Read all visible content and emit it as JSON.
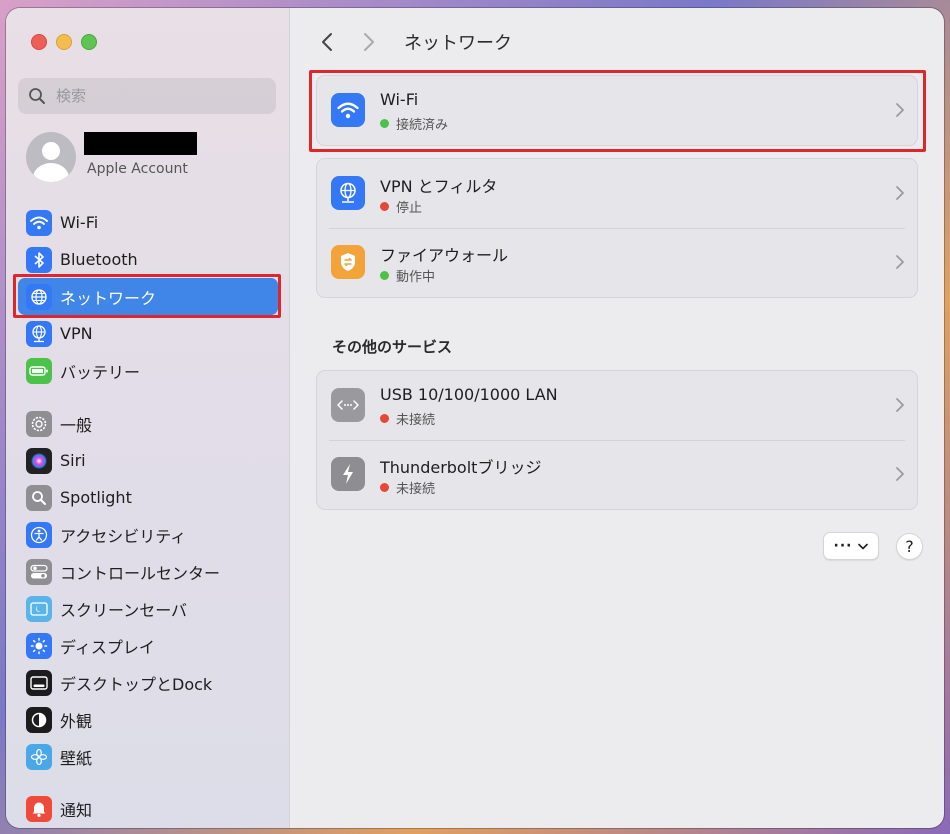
{
  "window": {
    "title": "ネットワーク"
  },
  "search": {
    "placeholder": "検索"
  },
  "account": {
    "subtitle": "Apple Account"
  },
  "sidebar": {
    "items": [
      {
        "label": "Wi-Fi",
        "icon": "wifi-icon",
        "color": "#3478f6"
      },
      {
        "label": "Bluetooth",
        "icon": "bluetooth-icon",
        "color": "#3478f6"
      },
      {
        "label": "ネットワーク",
        "icon": "globe-icon",
        "color": "#3478f6",
        "selected": true
      },
      {
        "label": "VPN",
        "icon": "vpn-globe-icon",
        "color": "#3478f6"
      },
      {
        "label": "バッテリー",
        "icon": "battery-icon",
        "color": "#4cc24a"
      },
      {
        "label": "一般",
        "icon": "gear-icon",
        "color": "#8e8e93"
      },
      {
        "label": "Siri",
        "icon": "siri-icon",
        "color": "#222222"
      },
      {
        "label": "Spotlight",
        "icon": "magnifier-icon",
        "color": "#8e8e93"
      },
      {
        "label": "アクセシビリティ",
        "icon": "accessibility-icon",
        "color": "#3478f6"
      },
      {
        "label": "コントロールセンター",
        "icon": "toggles-icon",
        "color": "#8e8e93"
      },
      {
        "label": "スクリーンセーバ",
        "icon": "screensaver-icon",
        "color": "#5ab4e8"
      },
      {
        "label": "ディスプレイ",
        "icon": "sun-icon",
        "color": "#3478f6"
      },
      {
        "label": "デスクトップとDock",
        "icon": "dock-icon",
        "color": "#1c1c1e"
      },
      {
        "label": "外観",
        "icon": "appearance-icon",
        "color": "#1c1c1e"
      },
      {
        "label": "壁紙",
        "icon": "flower-icon",
        "color": "#4aa8e8"
      },
      {
        "label": "通知",
        "icon": "bell-icon",
        "color": "#ef4b3b"
      }
    ]
  },
  "main": {
    "wifi": {
      "name": "Wi-Fi",
      "status": "接続済み",
      "status_color": "#4cc24a"
    },
    "vpn": {
      "name": "VPN とフィルタ",
      "status": "停止",
      "status_color": "#e8463a"
    },
    "firewall": {
      "name": "ファイアウォール",
      "status": "動作中",
      "status_color": "#4cc24a"
    },
    "other_services_title": "その他のサービス",
    "usb": {
      "name": "USB 10/100/1000 LAN",
      "status": "未接続",
      "status_color": "#e8463a"
    },
    "thunderbolt": {
      "name": "Thunderboltブリッジ",
      "status": "未接続",
      "status_color": "#e8463a"
    },
    "more_label": "···",
    "help_label": "?"
  }
}
